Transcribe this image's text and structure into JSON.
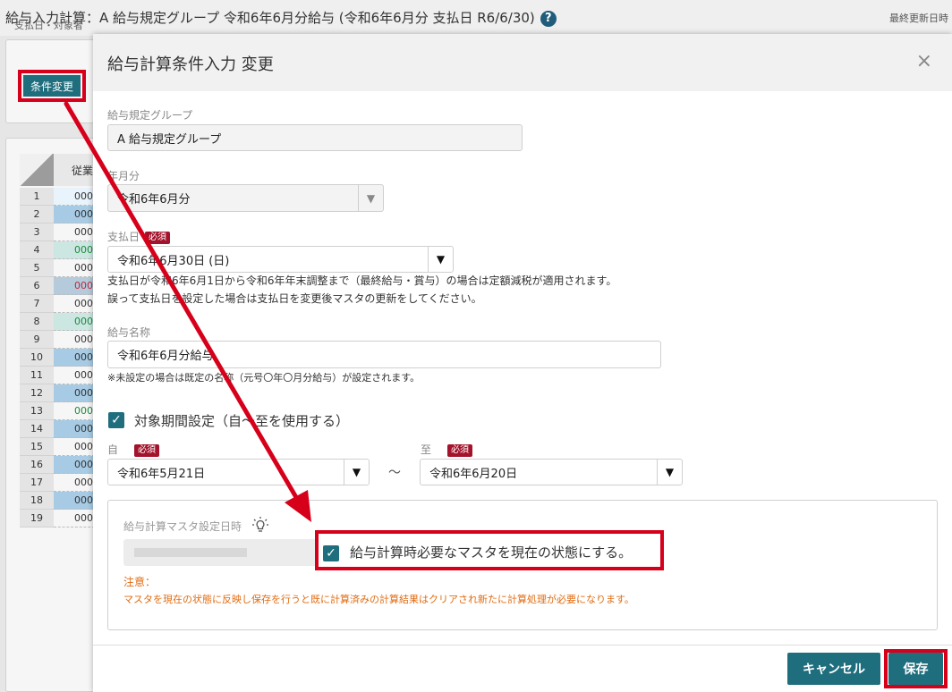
{
  "background": {
    "title": "給与入力計算：A 給与規定グループ 令和6年6月分給与 (令和6年6月分 支払日 R6/6/30)",
    "help_icon": "?",
    "last_updated_label": "最終更新日時",
    "panel_label": "支払日・対象者",
    "condition_button": "条件変更",
    "grid_header": "従業",
    "rows": [
      {
        "num": "1",
        "val": "000"
      },
      {
        "num": "2",
        "val": "000"
      },
      {
        "num": "3",
        "val": "000"
      },
      {
        "num": "4",
        "val": "000"
      },
      {
        "num": "5",
        "val": "000"
      },
      {
        "num": "6",
        "val": "000"
      },
      {
        "num": "7",
        "val": "000"
      },
      {
        "num": "8",
        "val": "000"
      },
      {
        "num": "9",
        "val": "000"
      },
      {
        "num": "10",
        "val": "000"
      },
      {
        "num": "11",
        "val": "000"
      },
      {
        "num": "12",
        "val": "000"
      },
      {
        "num": "13",
        "val": "000"
      },
      {
        "num": "14",
        "val": "000"
      },
      {
        "num": "15",
        "val": "000"
      },
      {
        "num": "16",
        "val": "000"
      },
      {
        "num": "17",
        "val": "000"
      },
      {
        "num": "18",
        "val": "000"
      },
      {
        "num": "19",
        "val": "000"
      }
    ]
  },
  "modal": {
    "title": "給与計算条件入力 変更",
    "close": "×",
    "required_tag": "必須",
    "group": {
      "label": "給与規定グループ",
      "value": "A 給与規定グループ"
    },
    "year_month": {
      "label": "年月分",
      "value": "令和6年6月分"
    },
    "pay_date": {
      "label": "支払日",
      "value": "令和6年6月30日 (日)",
      "note1": "支払日が令和6年6月1日から令和6年年末調整まで（最終給与・賞与）の場合は定額減税が適用されます。",
      "note2": "誤って支払日を設定した場合は支払日を変更後マスタの更新をしてください。"
    },
    "pay_name": {
      "label": "給与名称",
      "value": "令和6年6月分給与",
      "note": "※未設定の場合は既定の名称（元号〇年〇月分給与）が設定されます。"
    },
    "period_checkbox": "対象期間設定（自～至を使用する）",
    "from": {
      "label": "自",
      "value": "令和6年5月21日"
    },
    "tilde": "～",
    "to": {
      "label": "至",
      "value": "令和6年6月20日"
    },
    "master": {
      "label": "給与計算マスタ設定日時",
      "checkbox_label": "給与計算時必要なマスタを現在の状態にする。",
      "caution_title": "注意：",
      "caution_text": "マスタを現在の状態に反映し保存を行うと既に計算済みの計算結果はクリアされ新たに計算処理が必要になります。"
    },
    "cancel_button": "キャンセル",
    "save_button": "保存"
  },
  "colors": {
    "accent": "#1f6e7e",
    "highlight": "#d7001b",
    "required": "#a3132c",
    "warning": "#e06c12"
  }
}
